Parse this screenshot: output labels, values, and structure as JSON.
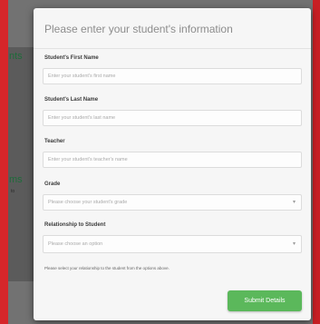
{
  "background": {
    "left_text_1": "nts",
    "left_text_2": "ms",
    "left_small_text": "to"
  },
  "modal": {
    "title": "Please enter your student's information"
  },
  "form": {
    "first_name": {
      "label": "Student's First Name",
      "placeholder": "Enter your student's first name"
    },
    "last_name": {
      "label": "Student's Last Name",
      "placeholder": "Enter your student's last name"
    },
    "teacher": {
      "label": "Teacher",
      "placeholder": "Enter your student's teacher's name"
    },
    "grade": {
      "label": "Grade",
      "placeholder": "Please choose your student's grade"
    },
    "relationship": {
      "label": "Relationship to Student",
      "placeholder": "Please choose an option",
      "help": "Please select your relationship to the student from the options above."
    }
  },
  "actions": {
    "submit_label": "Submit Details"
  },
  "colors": {
    "accent_green": "#5bb85b",
    "page_red": "#c81f24"
  }
}
